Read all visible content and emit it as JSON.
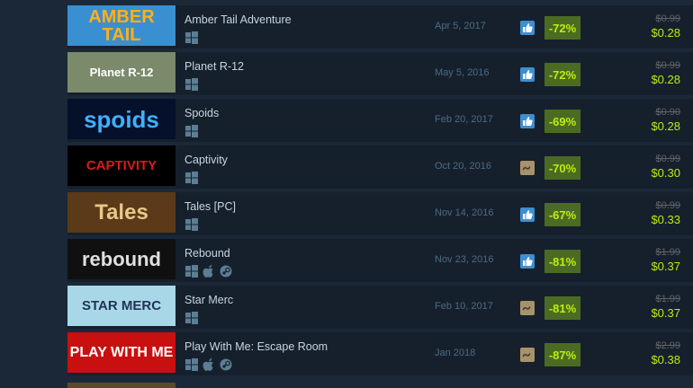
{
  "games": [
    {
      "title": "Amber Tail Adventure",
      "date": "Apr 5, 2017",
      "review": "positive",
      "discount": "-72%",
      "original_price": "$0.99",
      "final_price": "$0.28",
      "platforms": [
        "windows"
      ],
      "thumb_text": "AMBER TAIL",
      "colors": {
        "thumb_bg": "#3a8fd0",
        "thumb_fg": "#ffb019"
      }
    },
    {
      "title": "Planet R-12",
      "date": "May 5, 2016",
      "review": "positive",
      "discount": "-72%",
      "original_price": "$0.99",
      "final_price": "$0.28",
      "platforms": [
        "windows"
      ],
      "thumb_text": "Planet R-12",
      "colors": {
        "thumb_bg": "#7a8a6a",
        "thumb_fg": "#ffffff"
      }
    },
    {
      "title": "Spoids",
      "date": "Feb 20, 2017",
      "review": "positive",
      "discount": "-69%",
      "original_price": "$0.90",
      "final_price": "$0.28",
      "platforms": [
        "windows"
      ],
      "thumb_text": "spoids",
      "colors": {
        "thumb_bg": "#05102a",
        "thumb_fg": "#3fb0ff"
      }
    },
    {
      "title": "Captivity",
      "date": "Oct 20, 2016",
      "review": "mixed",
      "discount": "-70%",
      "original_price": "$0.99",
      "final_price": "$0.30",
      "platforms": [
        "windows"
      ],
      "thumb_text": "CAPTIVITY",
      "colors": {
        "thumb_bg": "#000000",
        "thumb_fg": "#d81b1b"
      }
    },
    {
      "title": "Tales [PC]",
      "date": "Nov 14, 2016",
      "review": "positive",
      "discount": "-67%",
      "original_price": "$0.99",
      "final_price": "$0.33",
      "platforms": [
        "windows"
      ],
      "thumb_text": "Tales",
      "colors": {
        "thumb_bg": "#5a3a18",
        "thumb_fg": "#e8c88a"
      }
    },
    {
      "title": "Rebound",
      "date": "Nov 23, 2016",
      "review": "positive",
      "discount": "-81%",
      "original_price": "$1.99",
      "final_price": "$0.37",
      "platforms": [
        "windows",
        "mac",
        "steam"
      ],
      "thumb_text": "rebound",
      "colors": {
        "thumb_bg": "#101010",
        "thumb_fg": "#e0e0e0"
      }
    },
    {
      "title": "Star Merc",
      "date": "Feb 10, 2017",
      "review": "mixed",
      "discount": "-81%",
      "original_price": "$1.99",
      "final_price": "$0.37",
      "platforms": [
        "windows"
      ],
      "thumb_text": "STAR MERC",
      "colors": {
        "thumb_bg": "#a8d8e8",
        "thumb_fg": "#223355"
      }
    },
    {
      "title": "Play With Me: Escape Room",
      "date": "Jan 2018",
      "review": "mixed",
      "discount": "-87%",
      "original_price": "$2.99",
      "final_price": "$0.38",
      "platforms": [
        "windows",
        "mac",
        "steam"
      ],
      "thumb_text": "PLAY WITH ME",
      "colors": {
        "thumb_bg": "#c81010",
        "thumb_fg": "#ffffff"
      }
    }
  ],
  "icons": {
    "windows": "windows-icon",
    "mac": "apple-icon",
    "steam": "steamos-icon",
    "positive": "thumbs-up-icon",
    "mixed": "tilde-icon"
  }
}
